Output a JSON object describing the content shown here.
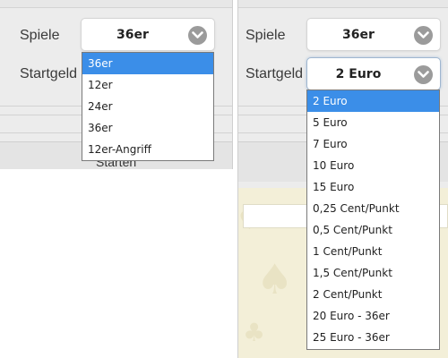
{
  "left": {
    "spiele_label": "Spiele",
    "spiele_value": "36er",
    "startgeld_label": "Startgeld",
    "options": [
      "36er",
      "12er",
      "24er",
      "36er",
      "12er-Angriff"
    ],
    "selected_index": 0,
    "start_button_label": "Starten"
  },
  "right": {
    "spiele_label": "Spiele",
    "spiele_value": "36er",
    "startgeld_label": "Startgeld",
    "startgeld_value": "2 Euro",
    "options": [
      "2 Euro",
      "5 Euro",
      "7 Euro",
      "10 Euro",
      "15 Euro",
      "0,25 Cent/Punkt",
      "0,5 Cent/Punkt",
      "1 Cent/Punkt",
      "1,5 Cent/Punkt",
      "2 Cent/Punkt",
      "20 Euro - 36er",
      "25 Euro - 36er"
    ],
    "selected_index": 0
  },
  "colors": {
    "selected_option_bg": "#3b8ee8",
    "panel_bg": "#ececec",
    "chevron_bg": "#9b9b9b",
    "game_bg": "#f3efd8"
  },
  "icons": {
    "chevron": "chevron-down-icon",
    "background_suit": "spade-icon"
  }
}
